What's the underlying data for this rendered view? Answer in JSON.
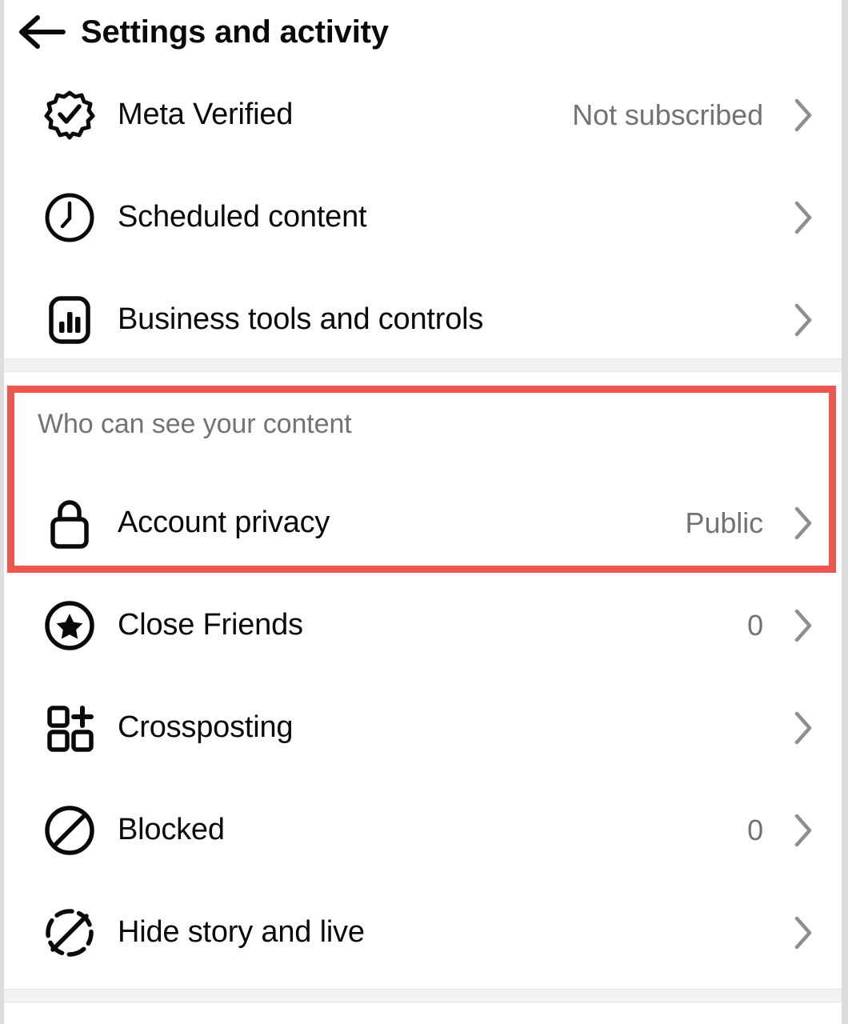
{
  "header": {
    "title": "Settings and activity",
    "back_icon": "arrow-left-icon"
  },
  "sections": [
    {
      "id": "top-section",
      "header": null,
      "rows": [
        {
          "icon": "meta-verified-badge-icon",
          "label": "Meta Verified",
          "value": "Not subscribed",
          "chevron": "chevron-right-icon"
        },
        {
          "icon": "clock-icon",
          "label": "Scheduled content",
          "value": "",
          "chevron": "chevron-right-icon"
        },
        {
          "icon": "business-bar-chart-icon",
          "label": "Business tools and controls",
          "value": "",
          "chevron": "chevron-right-icon"
        }
      ]
    },
    {
      "id": "who-can-see-your-content",
      "header": "Who can see your content",
      "rows": [
        {
          "icon": "lock-icon",
          "label": "Account privacy",
          "value": "Public",
          "chevron": "chevron-right-icon"
        },
        {
          "icon": "close-friends-star-icon",
          "label": "Close Friends",
          "value": "0",
          "chevron": "chevron-right-icon"
        },
        {
          "icon": "crossposting-grid-plus-icon",
          "label": "Crossposting",
          "value": "",
          "chevron": "chevron-right-icon"
        },
        {
          "icon": "blocked-icon",
          "label": "Blocked",
          "value": "0",
          "chevron": "chevron-right-icon"
        },
        {
          "icon": "hide-story-icon",
          "label": "Hide story and live",
          "value": "",
          "chevron": "chevron-right-icon"
        }
      ]
    }
  ],
  "annotation": {
    "label": "highlight-account-privacy",
    "color": "#ec5750"
  },
  "colors": {
    "text_primary": "#0a0a0a",
    "text_secondary": "#737373",
    "chevron": "#8e8e8e",
    "divider": "#f2f2f2",
    "page_edge": "#dddddd",
    "annotation_red": "#ec5750"
  }
}
